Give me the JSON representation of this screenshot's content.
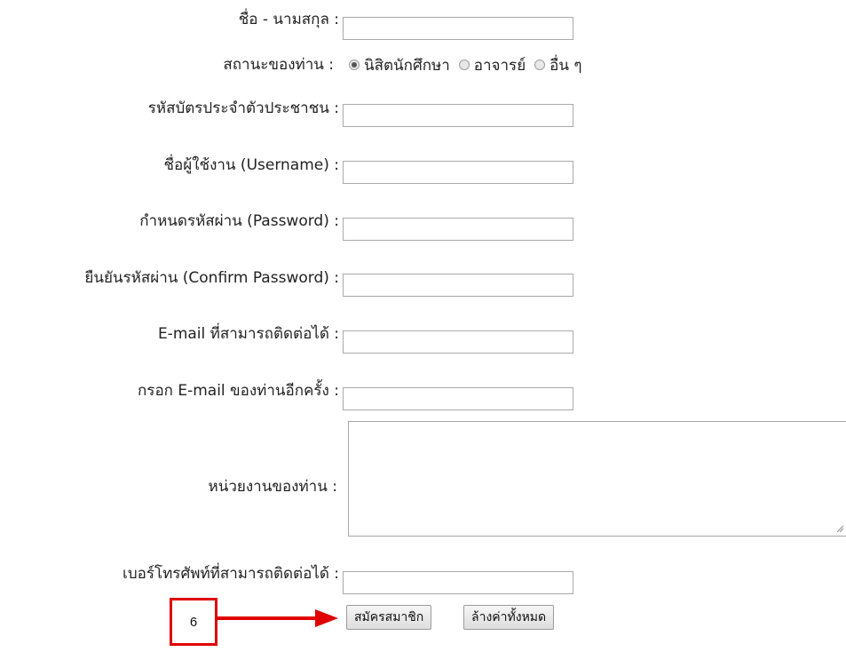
{
  "form": {
    "fullname": {
      "label": "ชื่อ - นามสกุล :",
      "value": ""
    },
    "status": {
      "label": "สถานะของท่าน :",
      "options": [
        {
          "label": "นิสิตนักศึกษา",
          "checked": true
        },
        {
          "label": "อาจารย์",
          "checked": false
        },
        {
          "label": "อื่น ๆ",
          "checked": false
        }
      ]
    },
    "citizen_id": {
      "label": "รหัสบัตรประจำตัวประชาชน :",
      "value": ""
    },
    "username": {
      "label": "ชื่อผู้ใช้งาน (Username) :",
      "value": ""
    },
    "password": {
      "label": "กำหนดรหัสผ่าน (Password) :",
      "value": ""
    },
    "confirm_password": {
      "label": "ยืนยันรหัสผ่าน (Confirm Password) :",
      "value": ""
    },
    "email": {
      "label": "E-mail ที่สามารถติดต่อได้ :",
      "value": ""
    },
    "email_confirm": {
      "label": "กรอก E-mail ของท่านอีกครั้ง :",
      "value": ""
    },
    "department": {
      "label": "หน่วยงานของท่าน :",
      "value": ""
    },
    "phone": {
      "label": "เบอร์โทรศัพท์ที่สามารถติดต่อได้ :",
      "value": ""
    },
    "buttons": {
      "submit": "สมัครสมาชิก",
      "reset": "ล้างค่าทั้งหมด"
    }
  },
  "annotation": {
    "step_number": "6",
    "color": "#e00000"
  }
}
